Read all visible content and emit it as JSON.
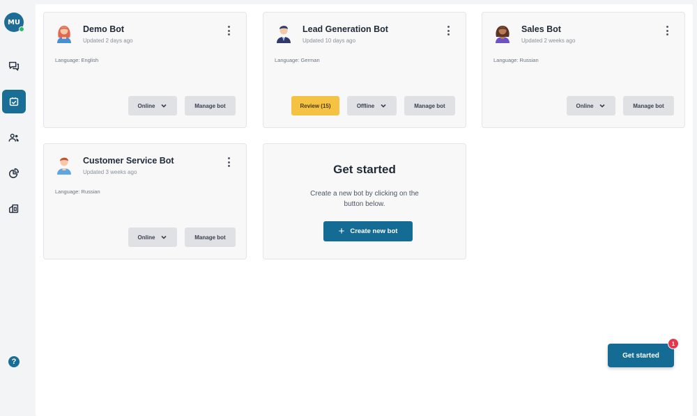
{
  "sidebar": {
    "user_initials": "MU",
    "active_item": "bots",
    "help_glyph": "?",
    "items": [
      {
        "id": "conversations",
        "icon": "chat-bubbles-icon"
      },
      {
        "id": "bots",
        "icon": "bot-box-icon"
      },
      {
        "id": "users",
        "icon": "users-icon"
      },
      {
        "id": "analytics",
        "icon": "pie-chart-icon"
      },
      {
        "id": "integrations",
        "icon": "building-icon"
      }
    ]
  },
  "bots": [
    {
      "name": "Demo Bot",
      "updated": "Updated 2 days ago",
      "language": "Language: English",
      "status_label": "Online",
      "manage_label": "Manage bot",
      "avatar_icon": "woman-redhead-avatar-icon"
    },
    {
      "name": "Lead Generation Bot",
      "updated": "Updated 10 days ago",
      "language": "Language: German",
      "review_label": "Review (15)",
      "status_label": "Offline",
      "manage_label": "Manage bot",
      "avatar_icon": "man-suit-avatar-icon"
    },
    {
      "name": "Sales Bot",
      "updated": "Updated 2 weeks ago",
      "language": "Language: Russian",
      "status_label": "Online",
      "manage_label": "Manage bot",
      "avatar_icon": "woman-curly-avatar-icon"
    },
    {
      "name": "Customer Service Bot",
      "updated": "Updated 3 weeks ago",
      "language": "Language: Russian",
      "status_label": "Online",
      "manage_label": "Manage bot",
      "avatar_icon": "man-blue-avatar-icon"
    }
  ],
  "get_started_card": {
    "title": "Get started",
    "text": "Create a new bot by clicking on the button below.",
    "button_label": "Create new bot"
  },
  "floating": {
    "button_label": "Get started",
    "badge_count": "1"
  },
  "colors": {
    "accent": "#146c94",
    "review": "#f5c244",
    "badge": "#e8364a",
    "online_dot": "#2fb86a"
  }
}
